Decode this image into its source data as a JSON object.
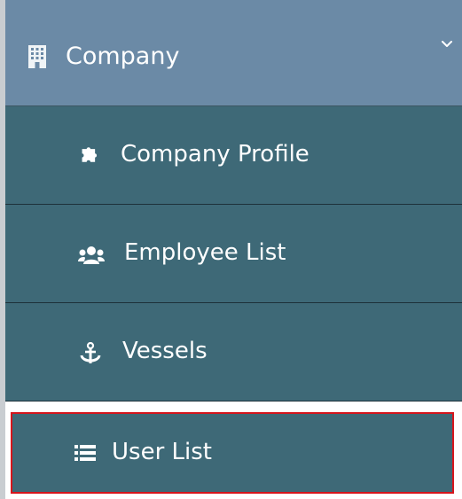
{
  "menu": {
    "section": {
      "label": "Company",
      "icon": "building-icon",
      "expand_icon": "chevron-down-icon"
    },
    "items": [
      {
        "label": "Company Profile",
        "icon": "puzzle-piece-icon"
      },
      {
        "label": "Employee List",
        "icon": "users-icon"
      },
      {
        "label": "Vessels",
        "icon": "anchor-icon"
      },
      {
        "label": "User List",
        "icon": "list-icon",
        "highlighted": true
      }
    ]
  },
  "colors": {
    "header_bg": "#6b8aa6",
    "item_bg": "#3e6977",
    "highlight_border": "#d5151c",
    "text": "#ffffff"
  }
}
